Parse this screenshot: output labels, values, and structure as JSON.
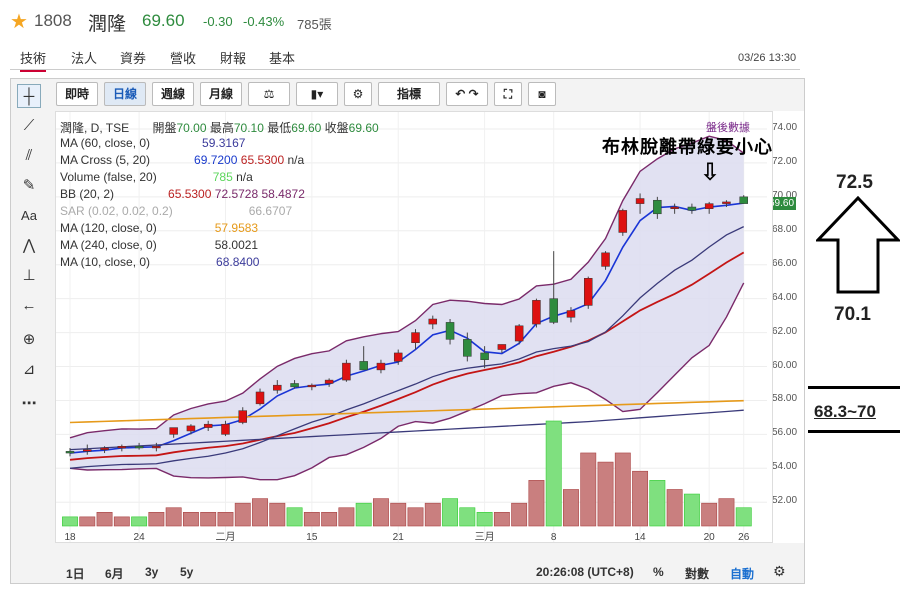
{
  "header": {
    "code": "1808",
    "name": "潤隆",
    "price": "69.60",
    "change": "-0.30",
    "change_pct": "-0.43%",
    "volume": "785張"
  },
  "tabs": [
    "技術",
    "法人",
    "資券",
    "營收",
    "財報",
    "基本"
  ],
  "datetime": "03/26 13:30",
  "toolbar": {
    "b1": "即時",
    "b2": "日線",
    "b3": "週線",
    "b4": "月線",
    "b5": "指標"
  },
  "legend": {
    "l0": "潤隆, D, TSE",
    "l0o": "開盤",
    "l0ov": "70.00",
    "l0h": "最高",
    "l0hv": "70.10",
    "l0l": "最低",
    "l0lv": "69.60",
    "l0c": "收盤",
    "l0cv": "69.60",
    "l1": "MA (60, close, 0)",
    "l1v": "59.3167",
    "l2": "MA Cross (5, 20)",
    "l2v": "69.7200",
    "l2v2": "65.5300",
    "l2v3": "n/a",
    "l3": "Volume (false, 20)",
    "l3v": "785",
    "l3v2": "n/a",
    "l4": "BB (20, 2)",
    "l4v": "65.5300",
    "l4v2": "72.5728",
    "l4v3": "58.4872",
    "l5": "SAR (0.02, 0.02, 0.2)",
    "l5v": "66.6707",
    "l6": "MA (120, close, 0)",
    "l6v": "57.9583",
    "l7": "MA (240, close, 0)",
    "l7v": "58.0021",
    "l8": "MA (10, close, 0)",
    "l8v": "68.8400"
  },
  "after_hours": "盤後數據",
  "annotation_main": "布林脫離帶綠要小心",
  "annotation_top": "72.5",
  "annotation_mid": "70.1",
  "annotation_range": "68.3~70",
  "last_price_tag": "69.60",
  "bottom": {
    "r1": "1日",
    "r2": "6月",
    "r3": "3y",
    "r4": "5y",
    "clock": "20:26:08 (UTC+8)",
    "pct": "%",
    "log": "對數",
    "auto": "自動"
  },
  "chart_data": {
    "type": "candlestick",
    "y_ticks": [
      "74.00",
      "72.00",
      "70.00",
      "68.00",
      "66.00",
      "64.00",
      "62.00",
      "60.00",
      "58.00",
      "56.00",
      "54.00",
      "52.00"
    ],
    "x_ticks": [
      "18",
      "24",
      "二月",
      "15",
      "21",
      "三月",
      "8",
      "14",
      "20",
      "26"
    ],
    "ylim": [
      50.6,
      75.0
    ],
    "candles": [
      {
        "o": 55.0,
        "h": 55.2,
        "l": 54.7,
        "c": 54.9
      },
      {
        "o": 55.0,
        "h": 55.4,
        "l": 54.8,
        "c": 55.1
      },
      {
        "o": 55.1,
        "h": 55.3,
        "l": 54.9,
        "c": 55.2
      },
      {
        "o": 55.2,
        "h": 55.4,
        "l": 55.0,
        "c": 55.3
      },
      {
        "o": 55.3,
        "h": 55.5,
        "l": 55.1,
        "c": 55.2
      },
      {
        "o": 55.2,
        "h": 55.5,
        "l": 55.0,
        "c": 55.3
      },
      {
        "o": 56.0,
        "h": 56.3,
        "l": 55.8,
        "c": 56.4
      },
      {
        "o": 56.2,
        "h": 56.6,
        "l": 56.0,
        "c": 56.5
      },
      {
        "o": 56.4,
        "h": 56.8,
        "l": 56.2,
        "c": 56.6
      },
      {
        "o": 56.0,
        "h": 56.8,
        "l": 55.9,
        "c": 56.6
      },
      {
        "o": 56.7,
        "h": 57.6,
        "l": 56.6,
        "c": 57.4
      },
      {
        "o": 57.8,
        "h": 58.7,
        "l": 57.7,
        "c": 58.5
      },
      {
        "o": 58.6,
        "h": 59.2,
        "l": 58.4,
        "c": 58.9
      },
      {
        "o": 59.0,
        "h": 59.2,
        "l": 58.7,
        "c": 58.8
      },
      {
        "o": 58.8,
        "h": 59.0,
        "l": 58.6,
        "c": 58.9
      },
      {
        "o": 59.0,
        "h": 59.3,
        "l": 58.8,
        "c": 59.2
      },
      {
        "o": 59.2,
        "h": 60.4,
        "l": 59.1,
        "c": 60.2
      },
      {
        "o": 60.3,
        "h": 61.2,
        "l": 59.8,
        "c": 59.8
      },
      {
        "o": 59.8,
        "h": 60.4,
        "l": 59.6,
        "c": 60.2
      },
      {
        "o": 60.3,
        "h": 61.0,
        "l": 60.1,
        "c": 60.8
      },
      {
        "o": 61.4,
        "h": 62.2,
        "l": 61.0,
        "c": 62.0
      },
      {
        "o": 62.5,
        "h": 63.0,
        "l": 62.2,
        "c": 62.8
      },
      {
        "o": 62.6,
        "h": 62.8,
        "l": 61.3,
        "c": 61.6
      },
      {
        "o": 61.6,
        "h": 62.0,
        "l": 60.3,
        "c": 60.6
      },
      {
        "o": 60.8,
        "h": 61.2,
        "l": 59.9,
        "c": 60.4
      },
      {
        "o": 61.0,
        "h": 61.3,
        "l": 60.8,
        "c": 61.3
      },
      {
        "o": 61.5,
        "h": 62.5,
        "l": 61.3,
        "c": 62.4
      },
      {
        "o": 62.5,
        "h": 64.0,
        "l": 62.3,
        "c": 63.9
      },
      {
        "o": 64.0,
        "h": 66.8,
        "l": 62.5,
        "c": 62.6
      },
      {
        "o": 62.9,
        "h": 63.5,
        "l": 62.6,
        "c": 63.3
      },
      {
        "o": 63.6,
        "h": 65.3,
        "l": 63.4,
        "c": 65.2
      },
      {
        "o": 65.9,
        "h": 66.8,
        "l": 65.7,
        "c": 66.7
      },
      {
        "o": 67.9,
        "h": 69.3,
        "l": 67.7,
        "c": 69.2
      },
      {
        "o": 69.6,
        "h": 70.2,
        "l": 69.0,
        "c": 69.9
      },
      {
        "o": 69.8,
        "h": 70.0,
        "l": 68.7,
        "c": 69.0
      },
      {
        "o": 69.3,
        "h": 69.6,
        "l": 69.0,
        "c": 69.4
      },
      {
        "o": 69.4,
        "h": 69.6,
        "l": 69.0,
        "c": 69.2
      },
      {
        "o": 69.3,
        "h": 69.7,
        "l": 69.0,
        "c": 69.6
      },
      {
        "o": 69.6,
        "h": 69.8,
        "l": 69.4,
        "c": 69.7
      },
      {
        "o": 70.0,
        "h": 70.1,
        "l": 69.6,
        "c": 69.6
      }
    ],
    "volumes": [
      2,
      2,
      3,
      2,
      2,
      3,
      4,
      3,
      3,
      3,
      5,
      6,
      5,
      4,
      3,
      3,
      4,
      5,
      6,
      5,
      4,
      5,
      6,
      4,
      3,
      3,
      5,
      10,
      23,
      8,
      16,
      14,
      16,
      12,
      10,
      8,
      7,
      5,
      6,
      4
    ]
  }
}
